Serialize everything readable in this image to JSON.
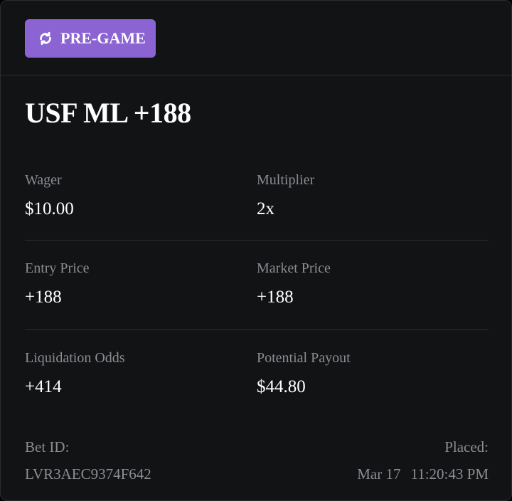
{
  "badge": {
    "label": "PRE-GAME",
    "icon": "refresh-icon",
    "color": "#8b63d3"
  },
  "bet": {
    "title": "USF ML +188"
  },
  "details": [
    {
      "label": "Wager",
      "value": "$10.00"
    },
    {
      "label": "Multiplier",
      "value": "2x"
    },
    {
      "label": "Entry Price",
      "value": "+188"
    },
    {
      "label": "Market Price",
      "value": "+188"
    },
    {
      "label": "Liquidation Odds",
      "value": "+414"
    },
    {
      "label": "Potential Payout",
      "value": "$44.80"
    }
  ],
  "footer": {
    "bet_id_label": "Bet ID:",
    "bet_id": "LVR3AEC9374F642",
    "placed_label": "Placed:",
    "placed_date": "Mar 17",
    "placed_time": "11:20:43 PM"
  }
}
